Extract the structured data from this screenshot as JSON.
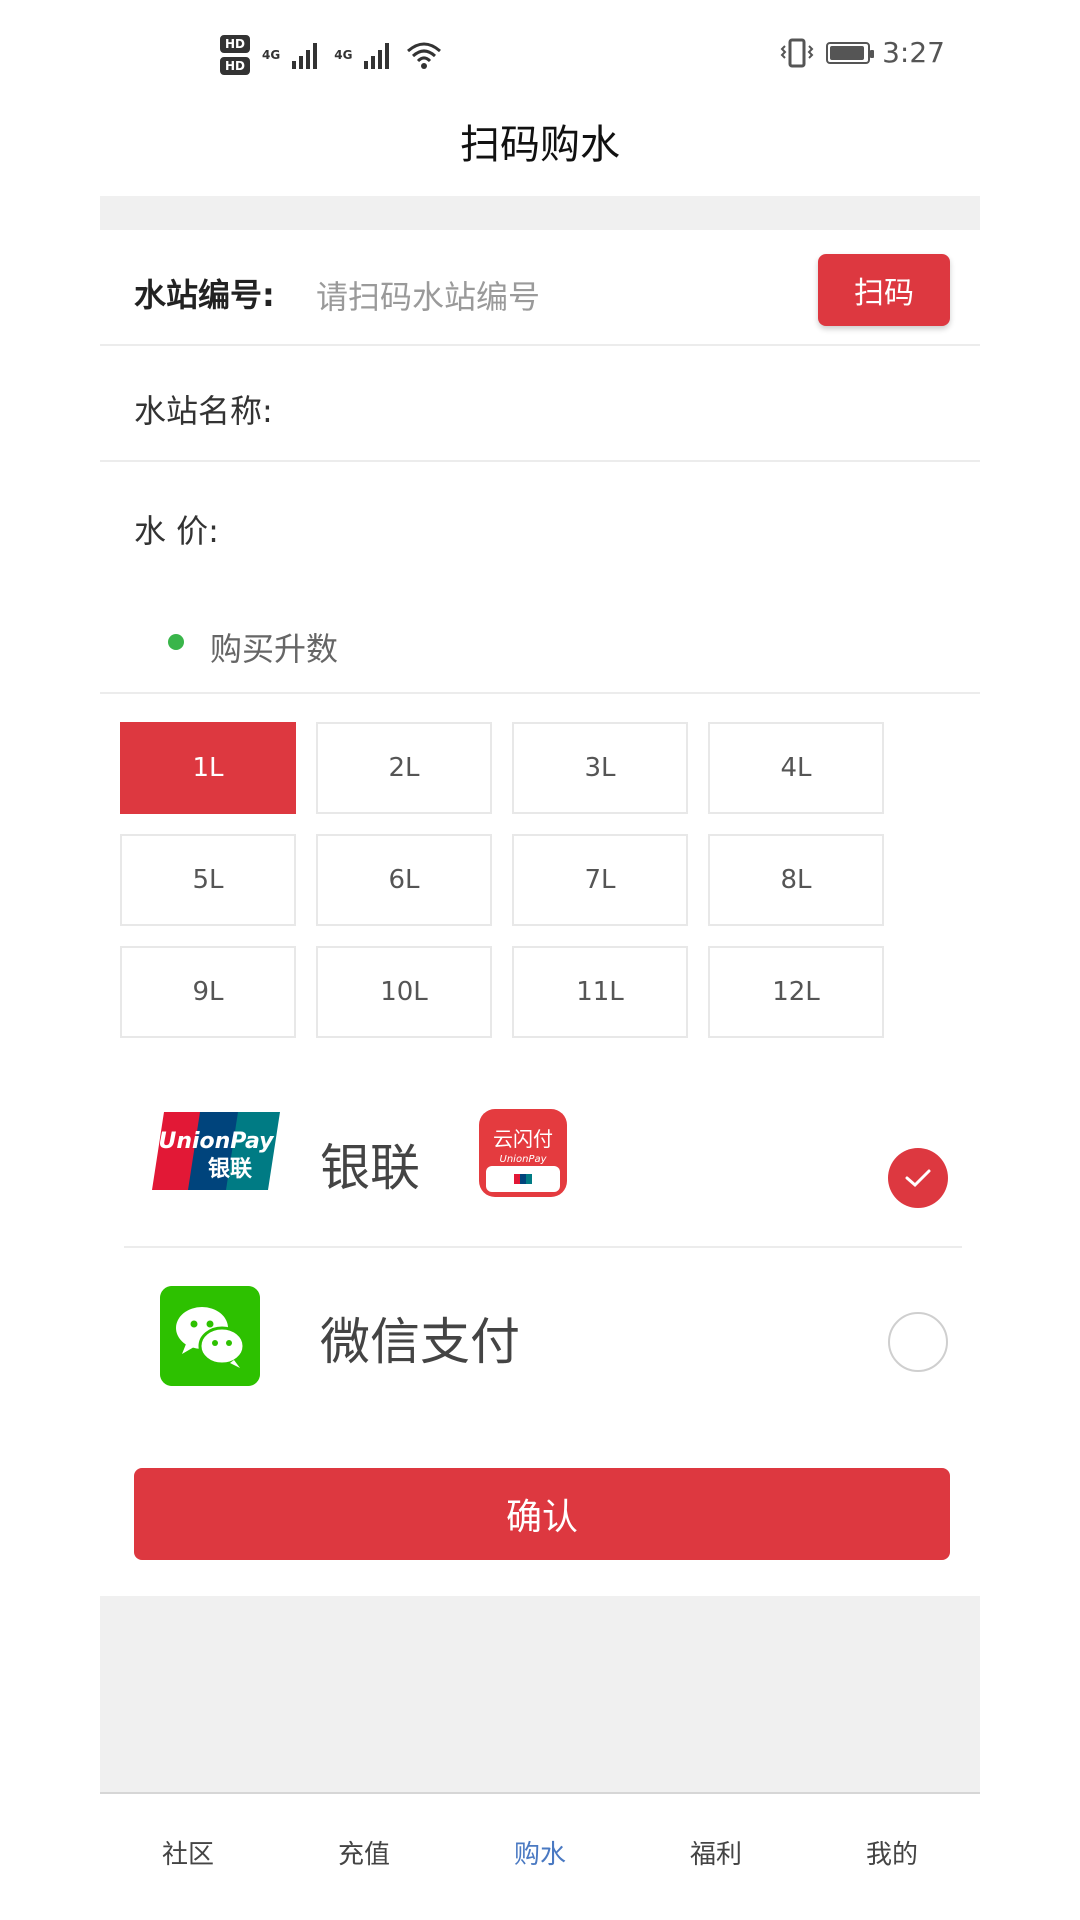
{
  "status_bar": {
    "hd_top": "HD",
    "hd_bottom": "HD",
    "net1": "4G",
    "net2": "4G",
    "time": "3:27"
  },
  "header": {
    "title": "扫码购水"
  },
  "station": {
    "code_label": "水站编号:",
    "code_placeholder": "请扫码水站编号",
    "scan_label": "扫码",
    "name_label": "水站名称:",
    "price_label": "水 价:"
  },
  "purchase": {
    "heading": "购买升数",
    "options": [
      "1L",
      "2L",
      "3L",
      "4L",
      "5L",
      "6L",
      "7L",
      "8L",
      "9L",
      "10L",
      "11L",
      "12L"
    ],
    "selected": "1L"
  },
  "payment": {
    "unionpay_label": "银联",
    "unionpay_logo_text": "UnionPay 银联",
    "yunshanfu_logo_text": "云闪付 UnionPay",
    "wechat_label": "微信支付",
    "selected": "unionpay"
  },
  "confirm_label": "确认",
  "tabs": [
    {
      "label": "社区"
    },
    {
      "label": "充值"
    },
    {
      "label": "购水",
      "active": true
    },
    {
      "label": "福利"
    },
    {
      "label": "我的"
    }
  ],
  "colors": {
    "accent": "#dd3840",
    "tab_active": "#4a79c2",
    "dot": "#39b54a",
    "wechat": "#2dc100"
  }
}
